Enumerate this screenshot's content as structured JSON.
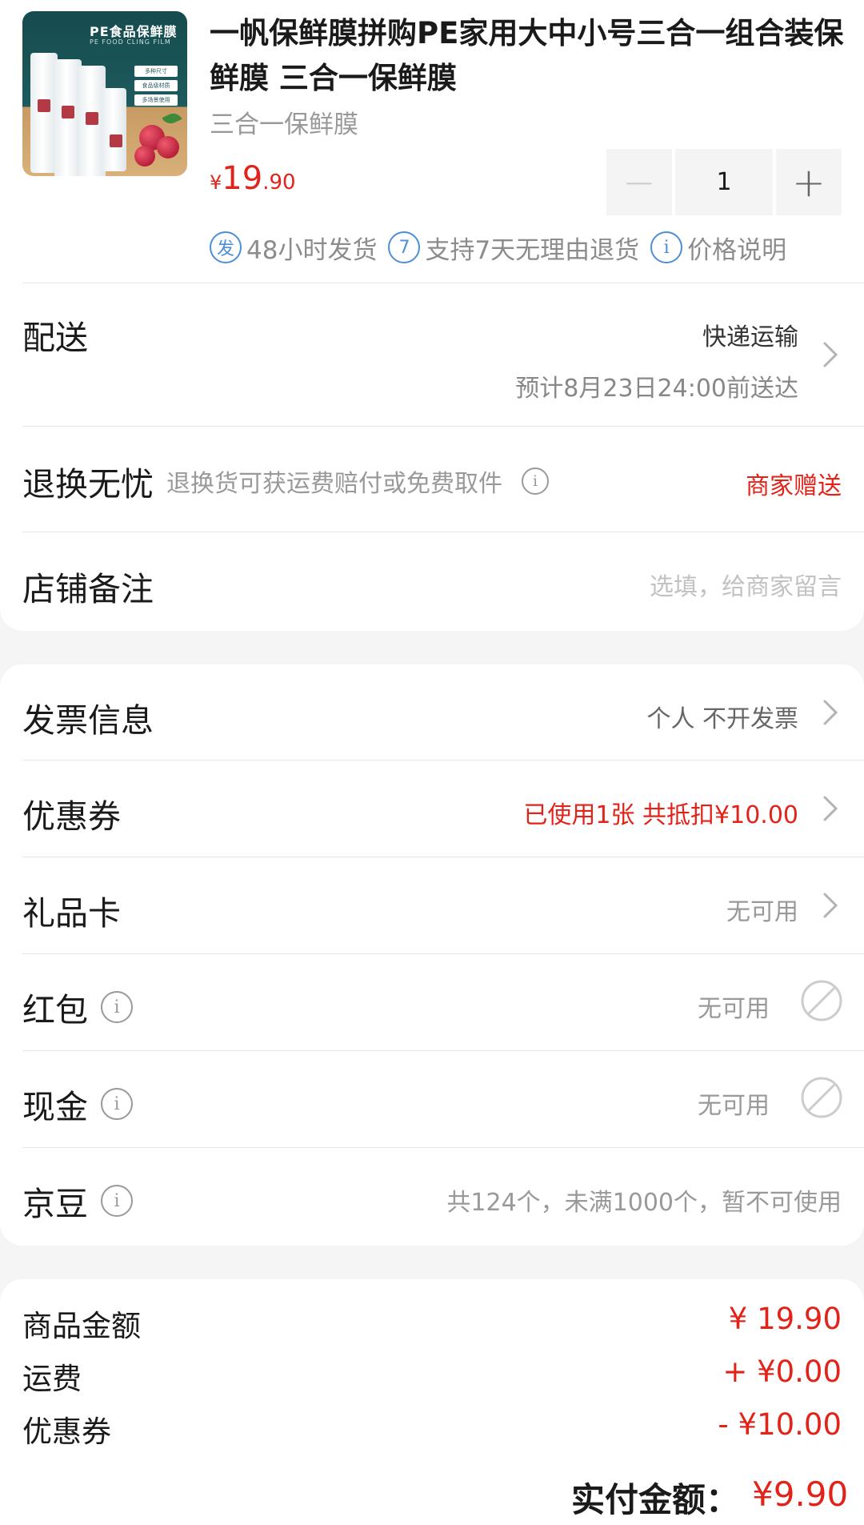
{
  "product": {
    "thumb_title": "PE食品保鲜膜",
    "thumb_subtitle": "PE FOOD CLING FILM",
    "thumb_tags": [
      "多种尺寸",
      "食品级材质",
      "多场景使用"
    ],
    "title": "一帆保鲜膜拼购PE家用大中小号三合一组合装保鲜膜 三合一保鲜膜",
    "spec": "三合一保鲜膜",
    "price_symbol": "¥",
    "price_integer": "19",
    "price_decimal": ".90",
    "quantity": "1",
    "minus_label": "−",
    "plus_label": "+"
  },
  "services": [
    {
      "badge": "发",
      "label": "48小时发货"
    },
    {
      "badge": "7",
      "label": "支持7天无理由退货"
    },
    {
      "badge": "i",
      "label": "价格说明"
    }
  ],
  "delivery": {
    "label": "配送",
    "method": "快递运输",
    "estimate": "预计8月23日24:00前送达"
  },
  "return_worry_free": {
    "label": "退换无忧",
    "description": "退换货可获运费赔付或免费取件",
    "value": "商家赠送"
  },
  "shop_note": {
    "label": "店铺备注",
    "placeholder": "选填，给商家留言"
  },
  "invoice": {
    "label": "发票信息",
    "value": "个人 不开发票"
  },
  "coupon": {
    "label": "优惠券",
    "value": "已使用1张 共抵扣¥10.00"
  },
  "gift_card": {
    "label": "礼品卡",
    "value": "无可用"
  },
  "red_packet": {
    "label": "红包",
    "value": "无可用"
  },
  "cash": {
    "label": "现金",
    "value": "无可用"
  },
  "jingdou": {
    "label": "京豆",
    "value": "共124个，未满1000个，暂不可使用"
  },
  "summary": {
    "goods_amount_label": "商品金额",
    "goods_amount": "¥ 19.90",
    "shipping_label": "运费",
    "shipping": "+ ¥0.00",
    "coupon_label": "优惠券",
    "coupon": "- ¥10.00",
    "total_label": "实付金额：",
    "total": "¥9.90"
  },
  "colors": {
    "accent_red": "#e2231a",
    "service_blue": "#4d8ed8",
    "page_bg": "#f5f5f5"
  }
}
